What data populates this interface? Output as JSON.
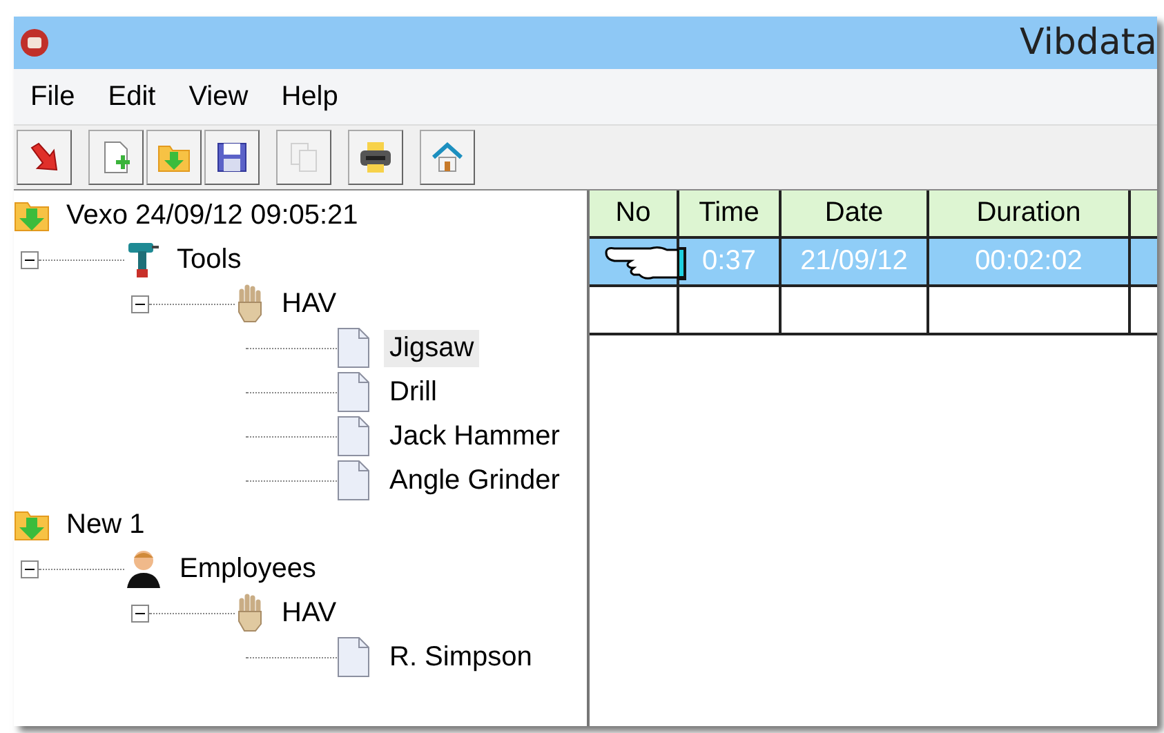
{
  "window": {
    "title": "Vibdata"
  },
  "menu": [
    "File",
    "Edit",
    "View",
    "Help"
  ],
  "toolbar": [
    {
      "kind": "exit",
      "disabled": false
    },
    {
      "kind": "new",
      "disabled": false
    },
    {
      "kind": "open",
      "disabled": false
    },
    {
      "kind": "save",
      "disabled": false
    },
    {
      "kind": "copy",
      "disabled": true
    },
    {
      "kind": "print",
      "disabled": false
    },
    {
      "kind": "home",
      "disabled": false
    }
  ],
  "tree": [
    {
      "label": "Vexo 24/09/12 09:05:21",
      "kind": "folder",
      "selected": false,
      "children": [
        {
          "label": "Tools",
          "kind": "drill",
          "expanded": true,
          "selected": false,
          "children": [
            {
              "label": "HAV",
              "kind": "hand",
              "expanded": true,
              "selected": false,
              "children": [
                {
                  "label": "Jigsaw",
                  "kind": "document",
                  "selected": true
                },
                {
                  "label": "Drill",
                  "kind": "document",
                  "selected": false
                },
                {
                  "label": "Jack Hammer",
                  "kind": "document",
                  "selected": false
                },
                {
                  "label": "Angle Grinder",
                  "kind": "document",
                  "selected": false
                }
              ]
            }
          ]
        }
      ]
    },
    {
      "label": "New 1",
      "kind": "folder",
      "selected": false,
      "children": [
        {
          "label": "Employees",
          "kind": "person",
          "expanded": true,
          "selected": false,
          "children": [
            {
              "label": "HAV",
              "kind": "hand",
              "expanded": true,
              "selected": false,
              "children": [
                {
                  "label": "R. Simpson",
                  "kind": "document",
                  "selected": false
                }
              ]
            }
          ]
        }
      ]
    }
  ],
  "table": {
    "columns": [
      "No",
      "Time",
      "Date",
      "Duration"
    ],
    "rows": [
      {
        "cells": [
          "",
          "0:37",
          "21/09/12",
          "00:02:02"
        ],
        "selected": true,
        "pointer": true
      }
    ]
  }
}
